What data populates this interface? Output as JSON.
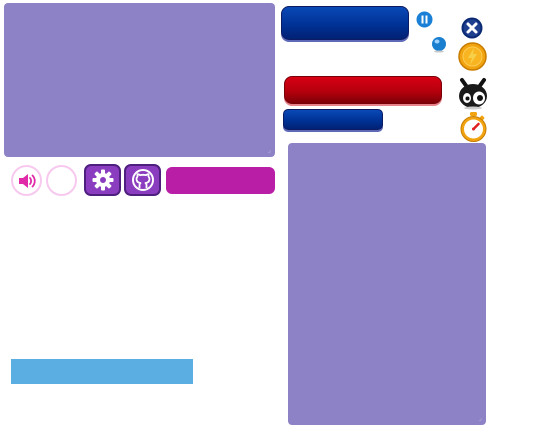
{
  "icons": {
    "sound": "speaker-icon",
    "settings": "gear-icon",
    "github": "github-icon",
    "pause": "pause-icon",
    "drop": "blue-orb-icon",
    "close": "close-icon",
    "coin": "gold-coin-icon",
    "character": "panda-head-icon",
    "timer": "stopwatch-icon"
  },
  "colors": {
    "panel": "#8d82c5",
    "accent_magenta": "#b81ea6",
    "button_purple": "#8b3dbf",
    "bar_blue": "#5aaee2",
    "pill_blue": "#003296",
    "pill_red": "#b5000d"
  }
}
